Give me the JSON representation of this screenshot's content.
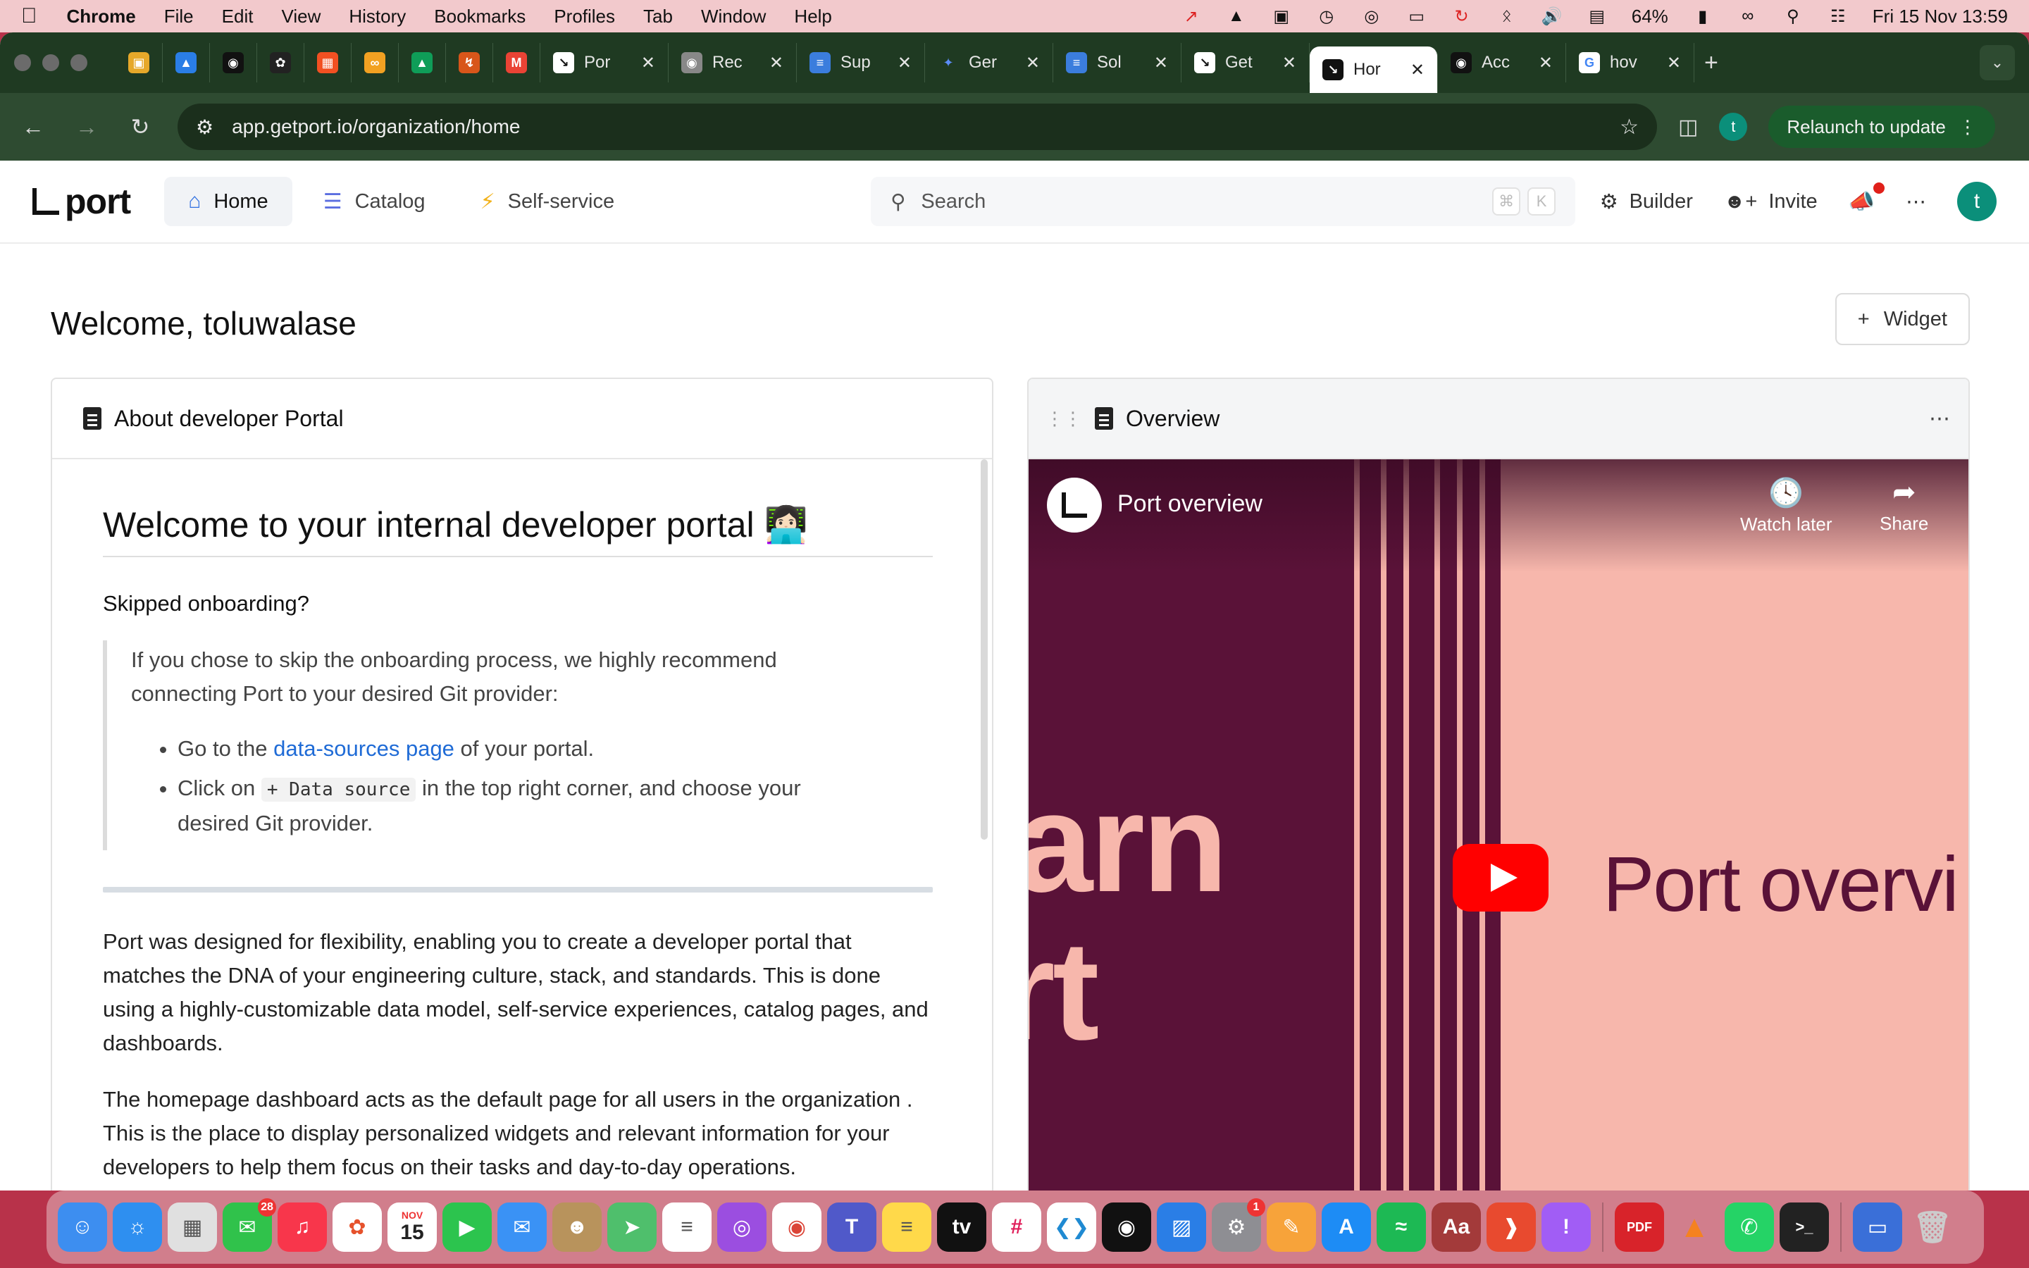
{
  "menubar": {
    "app": "Chrome",
    "items": [
      "File",
      "Edit",
      "View",
      "History",
      "Bookmarks",
      "Profiles",
      "Tab",
      "Window",
      "Help"
    ],
    "battery": "64%",
    "datetime": "Fri 15 Nov  13:59"
  },
  "tabs": [
    {
      "title": "Por",
      "icon": "port-icon"
    },
    {
      "title": "Rec",
      "icon": "globe-icon"
    },
    {
      "title": "Sup",
      "icon": "docs-icon"
    },
    {
      "title": "Ger",
      "icon": "gemini-icon"
    },
    {
      "title": "Sol",
      "icon": "docs-icon"
    },
    {
      "title": "Get",
      "icon": "port-icon"
    },
    {
      "title": "Hor",
      "icon": "port-icon",
      "active": true
    },
    {
      "title": "Acc",
      "icon": "github-icon"
    },
    {
      "title": "hov",
      "icon": "google-icon"
    }
  ],
  "toolbar": {
    "url": "app.getport.io/organization/home",
    "relaunch_label": "Relaunch to update",
    "profile_initial": "t"
  },
  "app": {
    "logo_text": "port",
    "nav": {
      "home": "Home",
      "catalog": "Catalog",
      "self_service": "Self-service"
    },
    "search_placeholder": "Search",
    "search_kbd": [
      "⌘",
      "K"
    ],
    "builder": "Builder",
    "invite": "Invite",
    "avatar_initial": "t"
  },
  "page": {
    "welcome": "Welcome, toluwalase",
    "widget_button": "Widget"
  },
  "about_card": {
    "title": "About developer Portal",
    "heading": "Welcome to your internal developer portal 👩🏻‍💻",
    "subheading": "Skipped onboarding?",
    "quote_text": "If you chose to skip the onboarding process, we highly recommend connecting Port to your desired Git provider:",
    "bullet1_prefix": "Go to the ",
    "bullet1_link": "data-sources page",
    "bullet1_suffix": " of your portal.",
    "bullet2_prefix": "Click on ",
    "bullet2_code": "+ Data source",
    "bullet2_suffix": " in the top right corner, and choose your desired Git provider.",
    "para1": "Port was designed for flexibility, enabling you to create a developer portal that matches the DNA of your engineering culture, stack, and standards. This is done using a highly-customizable data model, self-service experiences, catalog pages, and dashboards.",
    "para2": "The homepage dashboard acts as the default page for all users in the organization . This is the place to display personalized widgets and relevant information for your developers to help them focus on their tasks and day-to-day operations."
  },
  "overview_card": {
    "title": "Overview",
    "video_title": "Port overview",
    "watch_later": "Watch later",
    "share": "Share",
    "bg_text1": "arn",
    "bg_text2": "rt",
    "big_title": "Port overvi"
  },
  "dock": {
    "messages_badge": "28",
    "calendar_month": "NOV",
    "calendar_day": "15",
    "settings_badge": "1"
  }
}
